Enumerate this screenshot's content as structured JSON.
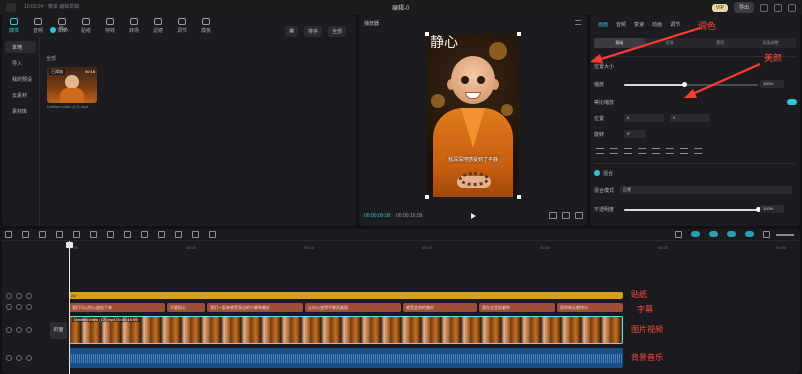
{
  "titlebar": {
    "left_text": "10:03:24 · 菜单 编辑草稿",
    "title": "编辑-0",
    "vip": "VIP",
    "export": "导出"
  },
  "tool_tabs": [
    {
      "label": "媒体",
      "icon": "media-icon"
    },
    {
      "label": "音频",
      "icon": "audio-icon"
    },
    {
      "label": "文本",
      "icon": "text-icon"
    },
    {
      "label": "贴纸",
      "icon": "sticker-icon"
    },
    {
      "label": "特效",
      "icon": "effects-icon"
    },
    {
      "label": "转场",
      "icon": "transition-icon"
    },
    {
      "label": "滤镜",
      "icon": "filter-icon"
    },
    {
      "label": "调节",
      "icon": "adjust-icon"
    },
    {
      "label": "模板",
      "icon": "template-icon"
    }
  ],
  "media_sidebar": [
    "本地",
    "导入",
    "我的预设",
    "云素材",
    "素材库"
  ],
  "media": {
    "import_label": "导入",
    "buttons": [
      "排序",
      "全部"
    ],
    "all_label": "全部",
    "item": {
      "badge": "已添加",
      "duration": "00:16",
      "name": "Untitled video (17).mp4"
    }
  },
  "player": {
    "title": "播放器",
    "calligraphy": "静心",
    "subtitle": "我深深地感受到了平静",
    "current_time": "00:00:00:00",
    "total_time": "00:00:16:09"
  },
  "props": {
    "tabs": [
      "画面",
      "音频",
      "变速",
      "动画",
      "调节"
    ],
    "subtabs": [
      "基础",
      "抠像",
      "蒙版",
      "画面调整"
    ],
    "position_size": "位置大小",
    "scale_label": "缩放",
    "scale_value": "100%",
    "uniform_label": "等比缩放",
    "position_label": "位置",
    "pos_x": "0",
    "pos_y": "0",
    "rotate_label": "旋转",
    "rotate_value": "0°",
    "blend_label": "混合",
    "blend_mode_label": "混合模式",
    "blend_mode_value": "正常",
    "opacity_label": "不透明度",
    "opacity_value": "100%",
    "scale_percent": 100,
    "opacity_percent": 100
  },
  "annotations": {
    "color_adjust": "调色",
    "beauty": "美颜"
  },
  "timeline": {
    "ruler_ticks": [
      "00:00",
      "00:05",
      "00:10",
      "00:15",
      "00:20",
      "00:25",
      "00:30",
      "00:35",
      "00:40"
    ],
    "sticker_label": "贴纸",
    "caption_label": "字幕",
    "video_label": "图片视频",
    "audio_label": "背景音乐",
    "cover_label": "封面",
    "sticker_clip": "Aa",
    "video_clip_name": "Untitled video (17).mp4  00:00:16:09",
    "captions": [
      "我们可以把心放松下来",
      "不要担心",
      "我们一起来感受身边的宁静和美好",
      "让内心变得平静而美丽",
      "感受此刻的美好",
      "我在这里陪着你",
      "愿你每天都快乐"
    ]
  },
  "colors": {
    "accent": "#2fc7d6",
    "annotation": "#ff4a3a",
    "sticker": "#d79e1c",
    "caption": "#9e4d38",
    "audio": "#1d4f87"
  }
}
